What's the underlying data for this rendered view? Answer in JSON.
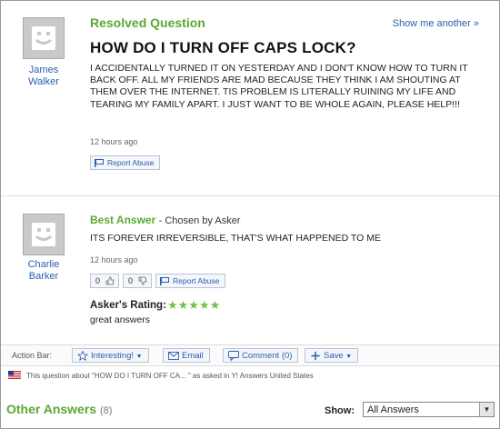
{
  "question": {
    "status": "Resolved Question",
    "show_another": "Show me another »",
    "asker": "James Walker",
    "title": "HOW DO I TURN OFF CAPS LOCK?",
    "body": "I ACCIDENTALLY TURNED IT ON YESTERDAY AND I DON'T KNOW HOW TO TURN IT BACK OFF. ALL MY FRIENDS ARE MAD BECAUSE THEY THINK I AM SHOUTING AT THEM OVER THE INTERNET. TIS PROBLEM IS LITERALLY RUINING MY LIFE AND TEARING MY FAMILY APART. I JUST WANT TO BE WHOLE AGAIN, PLEASE HELP!!!",
    "timestamp": "12 hours ago",
    "report_label": "Report Abuse"
  },
  "best_answer": {
    "label": "Best Answer",
    "chosen_by": "- Chosen by Asker",
    "answerer": "Charlie Barker",
    "body": "ITS FOREVER IRREVERSIBLE, THAT'S WHAT HAPPENED TO ME",
    "timestamp": "12 hours ago",
    "thumbs_up": "0",
    "thumbs_down": "0",
    "report_label": "Report Abuse",
    "rating_label": "Asker's Rating:",
    "rating_stars": "★★★★★",
    "rating_value": 5,
    "rating_comment": "great answers"
  },
  "action_bar": {
    "label": "Action Bar:",
    "interesting": "Interesting!",
    "email": "Email",
    "comment": "Comment (0)",
    "save": "Save"
  },
  "about": "This question about \"HOW DO I TURN OFF CA... \" as asked in Y! Answers United States",
  "other_answers": {
    "label": "Other Answers",
    "count": "(8)",
    "show_label": "Show:",
    "show_value": "All Answers"
  },
  "colors": {
    "accent_green": "#5aa832",
    "link_blue": "#2a5db0",
    "star_green": "#6ec443"
  }
}
